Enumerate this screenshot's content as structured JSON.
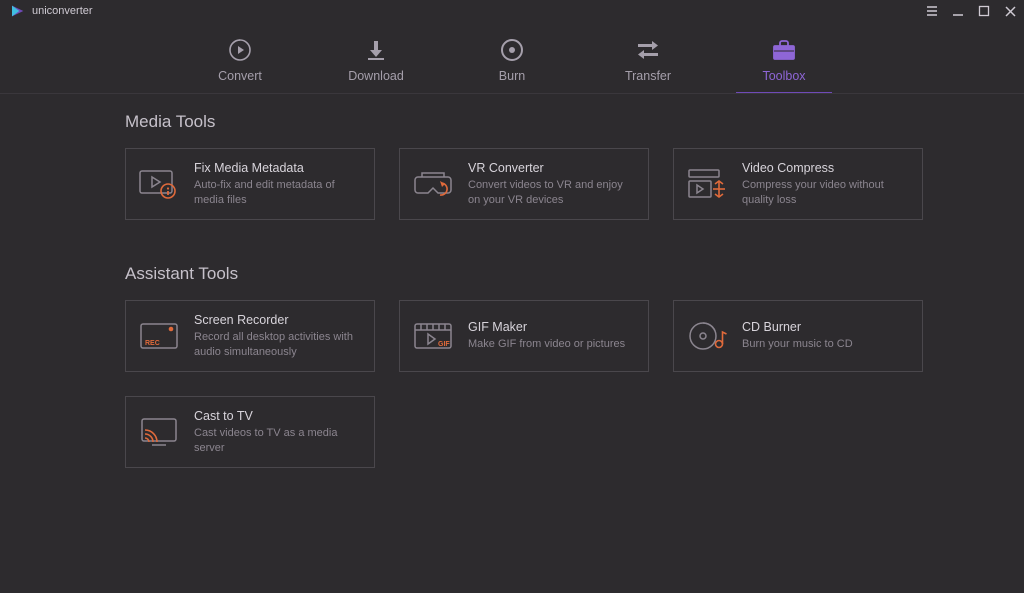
{
  "app": {
    "name": "uniconverter"
  },
  "nav": {
    "items": [
      {
        "label": "Convert"
      },
      {
        "label": "Download"
      },
      {
        "label": "Burn"
      },
      {
        "label": "Transfer"
      },
      {
        "label": "Toolbox"
      }
    ],
    "activeIndex": 4
  },
  "sections": {
    "media": {
      "title": "Media Tools",
      "cards": [
        {
          "title": "Fix Media Metadata",
          "desc": "Auto-fix and edit metadata of media files"
        },
        {
          "title": "VR Converter",
          "desc": "Convert videos to VR and enjoy on your VR devices"
        },
        {
          "title": "Video Compress",
          "desc": "Compress your video without quality loss"
        }
      ]
    },
    "assistant": {
      "title": "Assistant Tools",
      "cards": [
        {
          "title": "Screen Recorder",
          "desc": "Record all desktop activities with audio simultaneously"
        },
        {
          "title": "GIF Maker",
          "desc": "Make GIF from video or pictures"
        },
        {
          "title": "CD Burner",
          "desc": "Burn your music to CD"
        },
        {
          "title": "Cast to TV",
          "desc": "Cast videos to TV as a media server"
        }
      ]
    }
  },
  "colors": {
    "accent": "#e06a3b"
  }
}
